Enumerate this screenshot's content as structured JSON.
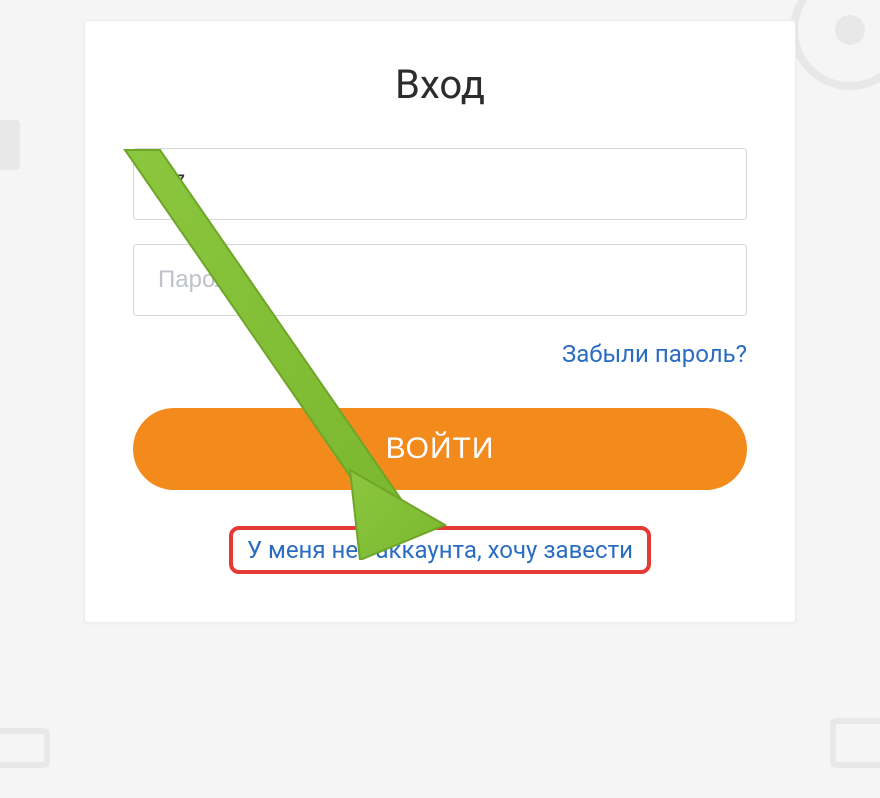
{
  "login": {
    "title": "Вход",
    "phone_value": "+7",
    "password_placeholder": "Пароль",
    "forgot_label": "Забыли пароль?",
    "submit_label": "ВОЙТИ",
    "register_label": "У меня нет аккаунта, хочу завести"
  }
}
